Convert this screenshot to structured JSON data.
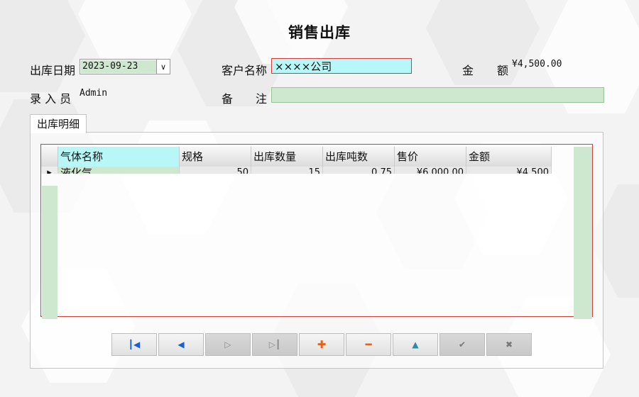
{
  "form": {
    "title": "销售出库",
    "date_label": "出库日期",
    "date_value": "2023-09-23",
    "date_dropdown": "∨",
    "customer_label": "客户名称",
    "customer_value": "××××公司",
    "amount_label_1": "金",
    "amount_label_2": "额",
    "amount_value": "¥4,500.00",
    "operator_label": "录 入 员",
    "operator_value": "Admin",
    "remark_label_1": "备",
    "remark_label_2": "注",
    "remark_value": ""
  },
  "tab": {
    "label": "出库明细"
  },
  "grid": {
    "columns": [
      "气体名称",
      "规格",
      "出库数量",
      "出库吨数",
      "售价",
      "金额"
    ],
    "rows": [
      {
        "indicator": "▸",
        "cells": [
          "液化气",
          "50",
          "15",
          "0.75",
          "¥6,000.00",
          "¥4,500"
        ]
      }
    ]
  },
  "toolbar": {
    "first_icon": "first-record-icon",
    "prev_icon": "prev-record-icon",
    "next_icon": "next-record-icon",
    "last_icon": "last-record-icon",
    "add_icon": "add-icon",
    "delete_icon": "delete-icon",
    "edit_icon": "edit-icon",
    "confirm_icon": "confirm-icon",
    "cancel_icon": "cancel-icon"
  },
  "colors": {
    "field_green": "#cde8cf",
    "field_cyan": "#b8f7f8",
    "frame_red": "#d63b3b",
    "nav_blue": "#1a5fcf",
    "nav_orange": "#e0651c"
  }
}
